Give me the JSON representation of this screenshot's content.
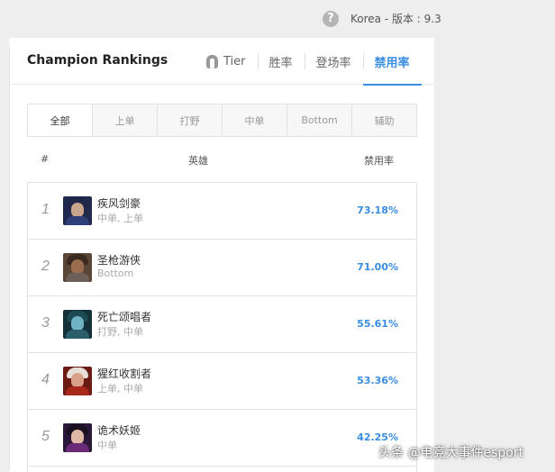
{
  "topbar": {
    "help_icon": "?",
    "region": "Korea - 版本 : 9.3"
  },
  "header": {
    "title": "Champion Rankings",
    "tabs": [
      {
        "label": "Tier",
        "icon": "helmet-icon"
      },
      {
        "label": "胜率"
      },
      {
        "label": "登场率"
      },
      {
        "label": "禁用率",
        "active": true
      }
    ]
  },
  "filters": [
    "全部",
    "上单",
    "打野",
    "中单",
    "Bottom",
    "辅助"
  ],
  "table": {
    "headers": {
      "rank": "#",
      "champion": "英雄",
      "ban_rate": "禁用率"
    },
    "rows": [
      {
        "rank": "1",
        "name": "疾风剑豪",
        "positions": "中单, 上单",
        "ban_rate": "73.18%"
      },
      {
        "rank": "2",
        "name": "圣枪游侠",
        "positions": "Bottom",
        "ban_rate": "71.00%"
      },
      {
        "rank": "3",
        "name": "死亡颂唱者",
        "positions": "打野, 中单",
        "ban_rate": "55.61%"
      },
      {
        "rank": "4",
        "name": "猩红收割者",
        "positions": "上单, 中单",
        "ban_rate": "53.36%"
      },
      {
        "rank": "5",
        "name": "诡术妖姬",
        "positions": "中单",
        "ban_rate": "42.25%"
      }
    ]
  },
  "watermark": "头条 @电竞大事件esport",
  "colors": {
    "accent": "#3a8de0",
    "background": "#eeeeee"
  }
}
